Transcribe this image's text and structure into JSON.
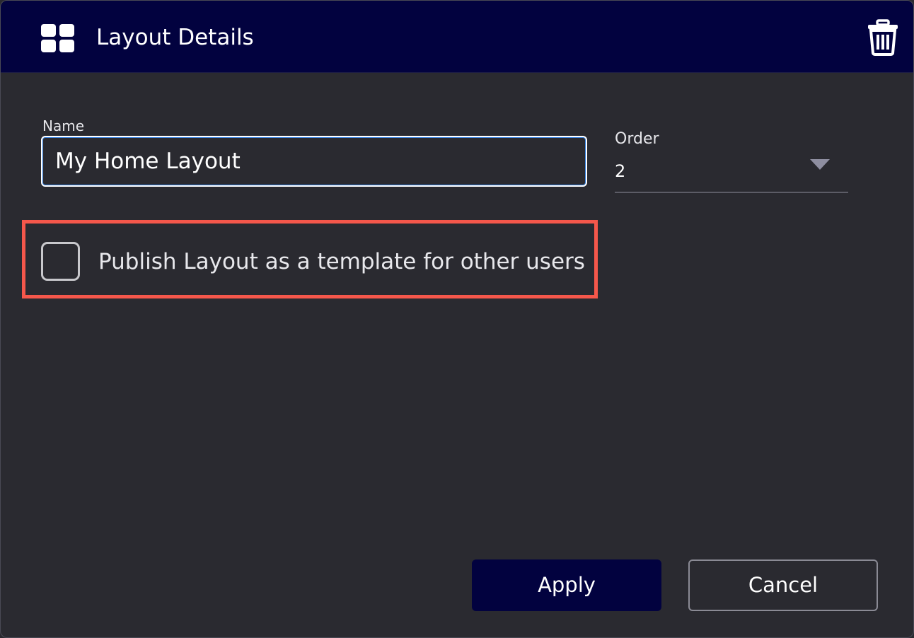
{
  "dialog": {
    "title": "Layout Details",
    "header_icon": "grid-icon",
    "delete_icon": "trash-icon"
  },
  "form": {
    "name_label": "Name",
    "name_value": "My Home Layout",
    "order_label": "Order",
    "order_value": "2",
    "publish_checkbox_label": "Publish Layout as a template for other users",
    "publish_checked": false
  },
  "buttons": {
    "apply_label": "Apply",
    "cancel_label": "Cancel"
  },
  "colors": {
    "header_bg": "#02023f",
    "body_bg": "#2a2a30",
    "highlight_border": "#f5574b",
    "input_focus": "#2f7de0"
  }
}
